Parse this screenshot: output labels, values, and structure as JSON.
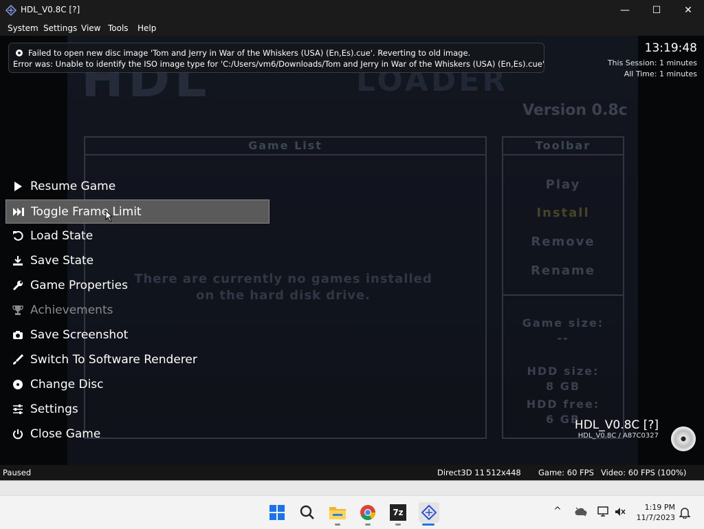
{
  "window": {
    "title": "HDL_V0.8C [?]",
    "controls": {
      "minimize": "—",
      "maximize": "☐",
      "close": "✕"
    }
  },
  "menubar": [
    "System",
    "Settings",
    "View",
    "Tools",
    "Help"
  ],
  "game_screen": {
    "logo": "HDL",
    "logo_subtitle": "LOADER",
    "version": "Version 0.8c",
    "game_list_header": "Game List",
    "toolbar_header": "Toolbar",
    "toolbar_buttons": [
      "Play",
      "Install",
      "Remove",
      "Rename"
    ],
    "empty_message_line1": "There are currently no games installed",
    "empty_message_line2": "on the hard disk drive.",
    "game_size_label": "Game size:",
    "game_size_value": "--",
    "hdd_size_label": "HDD size:",
    "hdd_size_value": "8 GB",
    "hdd_free_label": "HDD free:",
    "hdd_free_value": "6 GB"
  },
  "notification": {
    "line1": "Failed to open new disc image 'Tom and Jerry in War of the Whiskers (USA) (En,Es).cue'. Reverting to old image.",
    "line2": "Error was: Unable to identify the ISO image type for 'C:/Users/vm6/Downloads/Tom and Jerry in War of the Whiskers (USA) (En,Es).cue'"
  },
  "overlay_clock": {
    "time": "13:19:48",
    "session": "This Session: 1 minutes",
    "all_time": "All Time: 1 minutes"
  },
  "pause_menu": [
    {
      "label": "Resume Game",
      "icon": "play-icon"
    },
    {
      "label": "Toggle Frame Limit",
      "icon": "fast-forward-icon",
      "selected": true
    },
    {
      "label": "Load State",
      "icon": "undo-icon"
    },
    {
      "label": "Save State",
      "icon": "download-icon"
    },
    {
      "label": "Game Properties",
      "icon": "wrench-icon"
    },
    {
      "label": "Achievements",
      "icon": "trophy-icon",
      "disabled": true
    },
    {
      "label": "Save Screenshot",
      "icon": "camera-icon"
    },
    {
      "label": "Switch To Software Renderer",
      "icon": "brush-icon"
    },
    {
      "label": "Change Disc",
      "icon": "disc-icon"
    },
    {
      "label": "Settings",
      "icon": "sliders-icon"
    },
    {
      "label": "Close Game",
      "icon": "power-icon"
    }
  ],
  "game_info": {
    "title": "HDL_V0.8C [?]",
    "serial": "HDL_V0.8C / A87C0327"
  },
  "statusbar": {
    "state": "Paused",
    "renderer": "Direct3D 11",
    "resolution": "512x448",
    "game_fps": "Game: 60 FPS",
    "video_fps": "Video: 60 FPS (100%)"
  },
  "taskbar": {
    "time": "1:19 PM",
    "date": "11/7/2023",
    "apps": [
      "start-icon",
      "search-icon",
      "file-explorer-icon",
      "chrome-icon",
      "7zip-icon",
      "pcsx2-icon"
    ],
    "app_7zip_label": "7z"
  }
}
